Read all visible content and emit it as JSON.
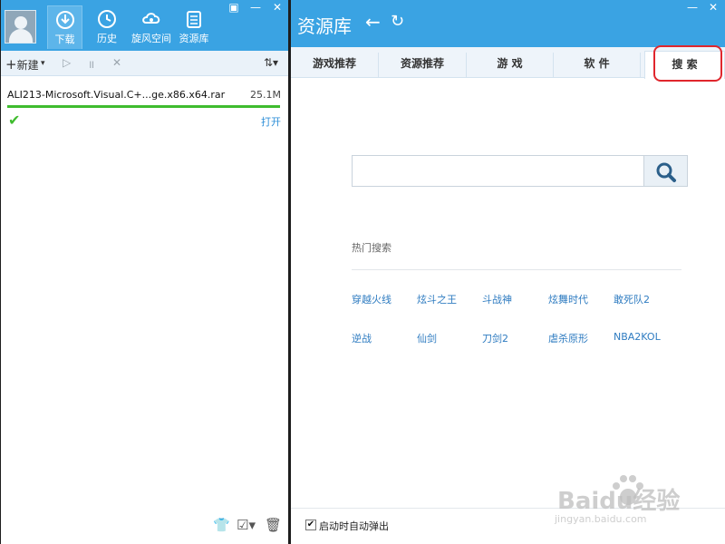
{
  "left_panel": {
    "nav": [
      {
        "label": "下载",
        "icon": "download-icon",
        "active": true
      },
      {
        "label": "历史",
        "icon": "history-clock-icon"
      },
      {
        "label": "旋风空间",
        "icon": "cloud-space-icon"
      },
      {
        "label": "资源库",
        "icon": "resource-library-icon"
      }
    ],
    "toolbar": {
      "new_label": "新建"
    },
    "download": {
      "filename": "ALI213-Microsoft.Visual.C+...ge.x86.x64.rar",
      "size": "25.1M",
      "progress_percent": 100,
      "open_label": "打开"
    }
  },
  "right_panel": {
    "title": "资源库",
    "tabs": [
      {
        "label": "游戏推荐"
      },
      {
        "label": "资源推荐"
      },
      {
        "label": "游 戏"
      },
      {
        "label": "软 件"
      },
      {
        "label": "搜 索",
        "active": true
      }
    ],
    "search": {
      "placeholder": "",
      "value": ""
    },
    "hot_search": {
      "title": "热门搜索",
      "items": [
        "穿越火线",
        "炫斗之王",
        "斗战神",
        "炫舞时代",
        "敢死队2",
        "逆战",
        "仙剑",
        "刀剑2",
        "虐杀原形",
        "NBA2KOL"
      ]
    },
    "autostart_label": "启动时自动弹出",
    "autostart_checked": true
  },
  "watermark": {
    "brand": "Baidu经验",
    "url": "jingyan.baidu.com"
  },
  "colors": {
    "header": "#3aa3e3",
    "progress": "#3fbc2e",
    "link": "#2f7cc1",
    "highlight_ring": "#e0262d"
  }
}
